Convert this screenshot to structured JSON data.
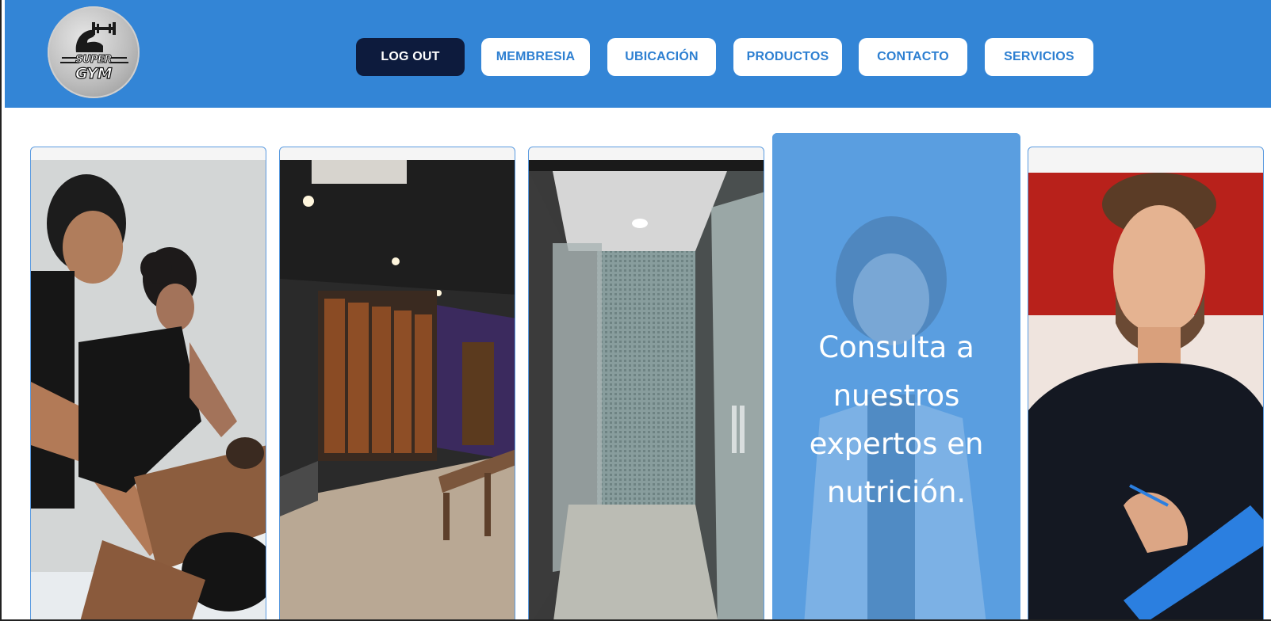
{
  "brand": {
    "logo_line1": "SUPER",
    "logo_line2": "GYM",
    "color": "#3385d6"
  },
  "nav": {
    "items": [
      {
        "label": "LOG OUT"
      },
      {
        "label": "MEMBRESIA"
      },
      {
        "label": "UBICACIÓN"
      },
      {
        "label": "PRODUCTOS"
      },
      {
        "label": "CONTACTO"
      },
      {
        "label": "SERVICIOS"
      }
    ]
  },
  "cards": [
    {
      "image": "massage-photo"
    },
    {
      "image": "locker-room-photo"
    },
    {
      "image": "shower-photo"
    },
    {
      "image": "nutritionist-photo",
      "caption": "Consulta a nuestros expertos en nutrición."
    },
    {
      "image": "trainer-photo"
    }
  ],
  "colors": {
    "header_bg": "#3385d6",
    "nav_button_bg": "#ffffff",
    "nav_button_text": "#2d7fd1",
    "logout_bg": "#0d1b3d",
    "highlight_card": "#5a9ee0"
  }
}
